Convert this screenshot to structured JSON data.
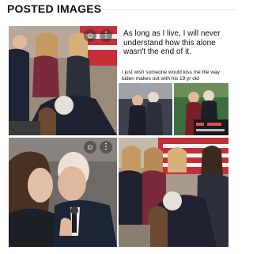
{
  "header": {
    "title": "POSTED IMAGES"
  },
  "tiles": [
    {
      "icons": [
        "search-icon",
        "more-icon"
      ]
    },
    {
      "caption_large": "As long as I live, I will never understand how this alone wasn't the end of it.",
      "caption_small": "I just wish someone would kiss me the way biden makes out with his 19 yr old granddaughter"
    },
    {
      "icons": [
        "search-icon",
        "more-icon"
      ]
    },
    {
      "icons": []
    }
  ],
  "icons": {
    "search": "⊙",
    "more": "⋮"
  },
  "colors": {
    "header_text": "#111111",
    "divider": "#e6e6e6",
    "flag_red": "#c3303a",
    "navy": "#1f2a44"
  }
}
